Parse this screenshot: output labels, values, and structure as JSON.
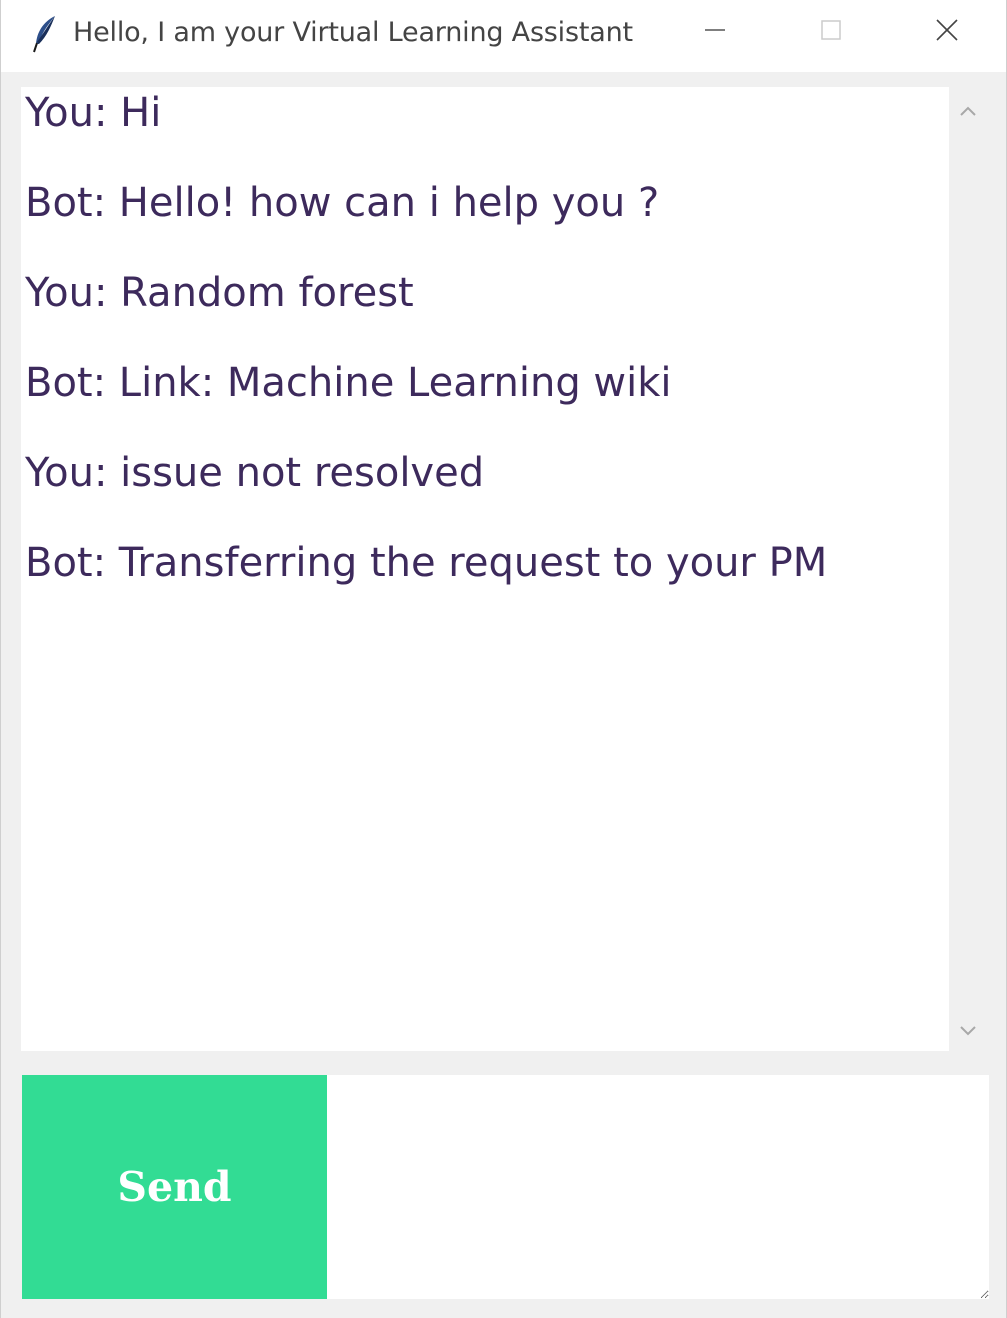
{
  "window": {
    "title": "Hello, I am your Virtual Learning Assistant",
    "icon": "feather-icon",
    "controls": [
      "minimize-icon",
      "maximize-icon",
      "close-icon"
    ]
  },
  "chat": {
    "messages": [
      "You: Hi",
      "Bot: Hello! how can i help you ?",
      "You: Random forest",
      "Bot: Link: Machine Learning wiki",
      "You: issue not resolved",
      "Bot: Transferring the request to your PM"
    ]
  },
  "input": {
    "send_label": "Send",
    "value": "",
    "placeholder": ""
  },
  "colors": {
    "send_button": "#32dc94",
    "chat_text": "#3d2a5c",
    "background": "#f0f0f0"
  }
}
